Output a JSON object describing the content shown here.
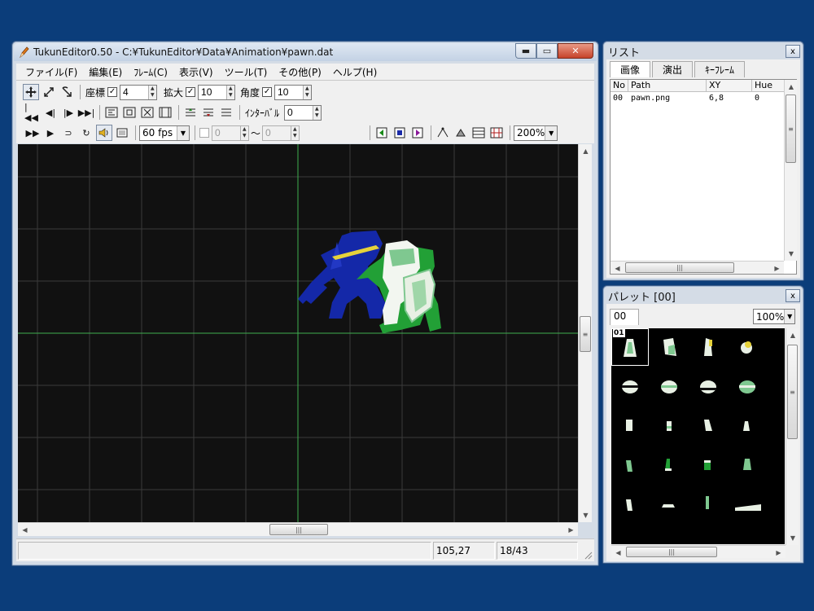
{
  "main_window": {
    "title": "TukunEditor0.50 - C:¥TukunEditor¥Data¥Animation¥pawn.dat",
    "menu": [
      "ファイル(F)",
      "編集(E)",
      "ﾌﾚｰﾑ(C)",
      "表示(V)",
      "ツール(T)",
      "その他(P)",
      "ヘルプ(H)"
    ],
    "caption_min": "▬",
    "caption_max": "▭",
    "caption_close": "✕"
  },
  "toolbar": {
    "coord_label": "座標",
    "coord_checked": true,
    "coord_value": "4",
    "scale_label": "拡大",
    "scale_checked": true,
    "scale_value": "10",
    "angle_label": "角度",
    "angle_checked": true,
    "angle_value": "10",
    "interval_label": "ｲﾝﾀｰﾊﾞﾙ",
    "interval_value": "0",
    "fps_value": "60 fps",
    "range_from": "0",
    "range_tilde": "～",
    "range_to": "0",
    "zoom_value": "200%",
    "check_mark": "✓"
  },
  "status": {
    "cursor_pos": "105,27",
    "frame": "18/43"
  },
  "list_panel": {
    "title": "リスト",
    "close": "x",
    "tabs": [
      "画像",
      "演出",
      "ｷｰﾌﾚｰﾑ"
    ],
    "columns": [
      "No",
      "Path",
      "XY",
      "Hue"
    ],
    "rows": [
      {
        "no": "00",
        "path": "pawn.png",
        "xy": "6,8",
        "hue": "0"
      }
    ]
  },
  "palette_panel": {
    "title": "パレット [00]",
    "close": "x",
    "tab": "00",
    "zoom_value": "100%",
    "selected_label": "01"
  },
  "colors": {
    "desktop": "#0b3d7a",
    "canvas": "#111111",
    "grid": "#3a3a3a",
    "axis": "#3fae4f",
    "knight_blue": "#1428a8",
    "knight_green": "#22a036"
  }
}
